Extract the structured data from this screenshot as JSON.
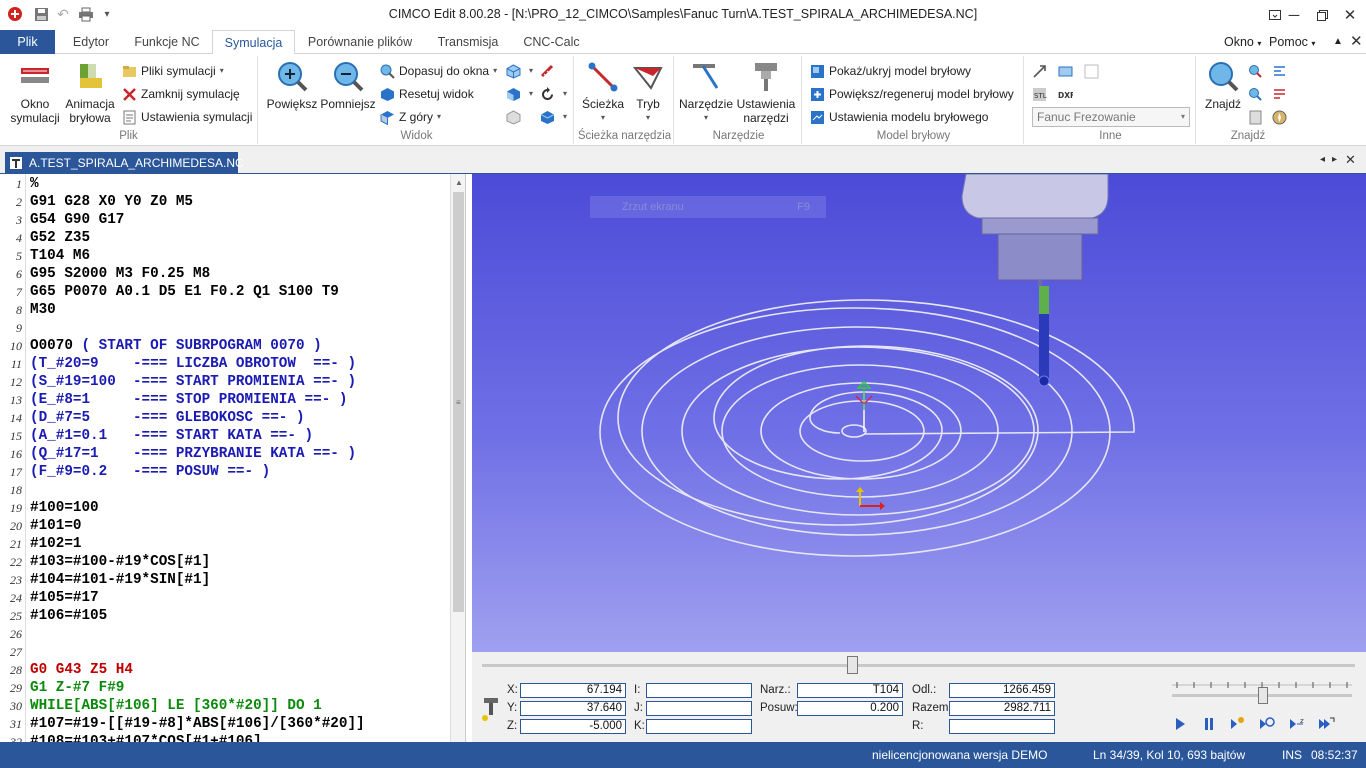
{
  "app": {
    "title": "CIMCO Edit 8.00.28 - [N:\\PRO_12_CIMCO\\Samples\\Fanuc Turn\\A.TEST_SPIRALA_ARCHIMEDESA.NC]"
  },
  "menu": {
    "file": "Plik",
    "tabs": [
      "Edytor",
      "Funkcje NC",
      "Symulacja",
      "Porównanie plików",
      "Transmisja",
      "CNC-Calc"
    ],
    "active": "Symulacja",
    "window": "Okno",
    "help": "Pomoc"
  },
  "ribbon": {
    "plik": {
      "label": "Plik",
      "okno": "Okno symulacji",
      "animacja": "Animacja bryłowa",
      "pliki": "Pliki symulacji",
      "zamknij": "Zamknij symulację",
      "ustawienia": "Ustawienia symulacji"
    },
    "widok": {
      "label": "Widok",
      "powieksz": "Powiększ",
      "pomniejsz": "Pomniejsz",
      "dopasuj": "Dopasuj do okna",
      "resetuj": "Resetuj widok",
      "zgory": "Z góry"
    },
    "sciezka": {
      "label": "Ścieżka narzędzia",
      "sciezka": "Ścieżka",
      "tryb": "Tryb"
    },
    "narzedzie": {
      "label": "Narzędzie",
      "narzedzie": "Narzędzie",
      "ustawienia": "Ustawienia narzędzi"
    },
    "model": {
      "label": "Model bryłowy",
      "pokaz": "Pokaż/ukryj model bryłowy",
      "powieksz": "Powiększ/regeneruj model bryłowy",
      "ustawienia": "Ustawienia modelu bryłowego"
    },
    "inne": {
      "label": "Inne",
      "machine": "Fanuc Frezowanie"
    },
    "znajdz": {
      "label": "Znajdź",
      "znajdz": "Znajdź"
    }
  },
  "document": {
    "tab": "A.TEST_SPIRALA_ARCHIMEDESA.NC"
  },
  "code_lines": [
    {
      "n": "1",
      "t": "%",
      "c": "#000"
    },
    {
      "n": "2",
      "t": "G91 G28 X0 Y0 Z0 M5",
      "c": "#000"
    },
    {
      "n": "3",
      "t": "G54 G90 G17",
      "c": "#000"
    },
    {
      "n": "4",
      "t": "G52 Z35",
      "c": "#000"
    },
    {
      "n": "5",
      "t": "T104 M6",
      "c": "#000"
    },
    {
      "n": "6",
      "t": "G95 S2000 M3 F0.25 M8",
      "c": "#000"
    },
    {
      "n": "7",
      "t": "G65 P0070 A0.1 D5 E1 F0.2 Q1 S100 T9",
      "c": "#000"
    },
    {
      "n": "8",
      "t": "M30",
      "c": "#000"
    },
    {
      "n": "9",
      "t": "",
      "c": "#000"
    },
    {
      "n": "10",
      "t": "O0070 ( START OF SUBRPOGRAM 0070 )",
      "c": "#000",
      "c2": "#1a1ab4",
      "split": 6
    },
    {
      "n": "11",
      "t": "(T_#20=9    -=== LICZBA OBROTOW  ==- )",
      "c": "#1a1ab4"
    },
    {
      "n": "12",
      "t": "(S_#19=100  -=== START PROMIENIA ==- )",
      "c": "#1a1ab4"
    },
    {
      "n": "13",
      "t": "(E_#8=1     -=== STOP PROMIENIA ==- )",
      "c": "#1a1ab4"
    },
    {
      "n": "14",
      "t": "(D_#7=5     -=== GLEBOKOSC ==- )",
      "c": "#1a1ab4"
    },
    {
      "n": "15",
      "t": "(A_#1=0.1   -=== START KATA ==- )",
      "c": "#1a1ab4"
    },
    {
      "n": "16",
      "t": "(Q_#17=1    -=== PRZYBRANIE KATA ==- )",
      "c": "#1a1ab4"
    },
    {
      "n": "17",
      "t": "(F_#9=0.2   -=== POSUW ==- )",
      "c": "#1a1ab4"
    },
    {
      "n": "18",
      "t": "",
      "c": "#000"
    },
    {
      "n": "19",
      "t": "#100=100",
      "c": "#000"
    },
    {
      "n": "20",
      "t": "#101=0",
      "c": "#000"
    },
    {
      "n": "21",
      "t": "#102=1",
      "c": "#000"
    },
    {
      "n": "22",
      "t": "#103=#100-#19*COS[#1]",
      "c": "#000"
    },
    {
      "n": "23",
      "t": "#104=#101-#19*SIN[#1]",
      "c": "#000"
    },
    {
      "n": "24",
      "t": "#105=#17",
      "c": "#000"
    },
    {
      "n": "25",
      "t": "#106=#105",
      "c": "#000"
    },
    {
      "n": "26",
      "t": "",
      "c": "#000"
    },
    {
      "n": "27",
      "t": "",
      "c": "#000"
    },
    {
      "n": "28",
      "t": "G0 G43 Z5 H4",
      "c": "#c00000"
    },
    {
      "n": "29",
      "t": "G1 Z-#7 F#9",
      "c": "#0a8a0a"
    },
    {
      "n": "30",
      "t": "WHILE[ABS[#106] LE [360*#20]] DO 1",
      "c": "#0a8a0a"
    },
    {
      "n": "31",
      "t": "#107=#19-[[#19-#8]*ABS[#106]/[360*#20]]",
      "c": "#000"
    },
    {
      "n": "32",
      "t": "#108=#103+#107*COS[#1+#106]",
      "c": "#000"
    }
  ],
  "viewport": {
    "hint": "Zrzut ekranu",
    "hint_key": "F9"
  },
  "coords": {
    "x_label": "X:",
    "x": "67.194",
    "y_label": "Y:",
    "y": "37.640",
    "z_label": "Z:",
    "z": "-5.000",
    "i_label": "I:",
    "i": "",
    "j_label": "J:",
    "j": "",
    "k_label": "K:",
    "k": "",
    "narz_label": "Narz.:",
    "narz": "T104",
    "posuw_label": "Posuw:",
    "posuw": "0.200",
    "odl_label": "Odl.:",
    "odl": "1266.459",
    "razem_label": "Razem:",
    "razem": "2982.711",
    "r_label": "R:",
    "r": ""
  },
  "status": {
    "license": "nielicencjonowana wersja DEMO",
    "position": "Ln 34/39, Kol 10, 693 bajtów",
    "mode": "INS",
    "time": "08:52:37"
  },
  "colors": {
    "accent": "#2b579a",
    "viewport_bg": "#5a5ae0"
  }
}
